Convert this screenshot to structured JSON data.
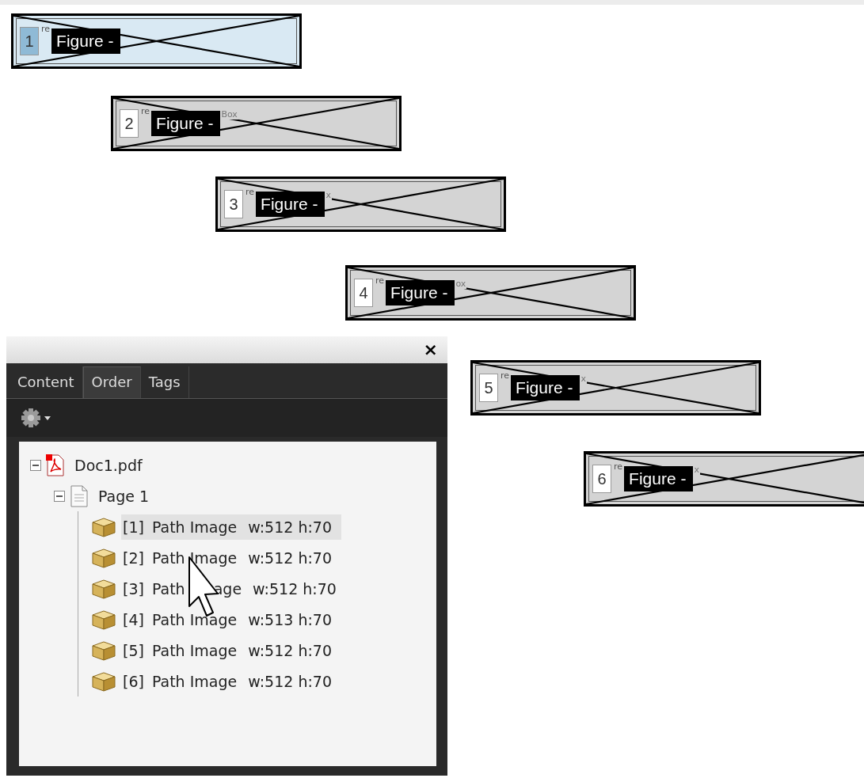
{
  "figures": [
    {
      "number": "1",
      "tag": "re",
      "label": "Figure -",
      "selected": true
    },
    {
      "number": "2",
      "tag": "re",
      "label": "Figure -",
      "fragment": "Box",
      "selected": false
    },
    {
      "number": "3",
      "tag": "re",
      "label": "Figure -",
      "fragment": "x",
      "selected": false
    },
    {
      "number": "4",
      "tag": "re",
      "label": "Figure -",
      "fragment": "ox",
      "selected": false
    },
    {
      "number": "5",
      "tag": "re",
      "label": "Figure -",
      "fragment": "x",
      "selected": false
    },
    {
      "number": "6",
      "tag": "re",
      "label": "Figure -",
      "fragment": "x",
      "selected": false
    }
  ],
  "panel": {
    "close": "×",
    "tabs": [
      {
        "label": "Content",
        "selected": false
      },
      {
        "label": "Order",
        "selected": true
      },
      {
        "label": "Tags",
        "selected": false
      }
    ],
    "tree": [
      {
        "label": "Doc1.pdf",
        "kind": "document",
        "expanded": true,
        "children": [
          {
            "label": "Page 1",
            "kind": "page",
            "expanded": true,
            "children": [
              {
                "index": "[1]",
                "name": "Path Image",
                "size": "w:512 h:70",
                "selected": true
              },
              {
                "index": "[2]",
                "name": "Path Image",
                "size": "w:512 h:70",
                "selected": false
              },
              {
                "index": "[3]",
                "name": "Path",
                "name_rest": "age",
                "size": "w:512 h:70",
                "selected": false
              },
              {
                "index": "[4]",
                "name": "Path Image",
                "size": "w:513 h:70",
                "selected": false
              },
              {
                "index": "[5]",
                "name": "Path Image",
                "size": "w:512 h:70",
                "selected": false
              },
              {
                "index": "[6]",
                "name": "Path Image",
                "size": "w:512 h:70",
                "selected": false
              }
            ]
          }
        ]
      }
    ]
  }
}
